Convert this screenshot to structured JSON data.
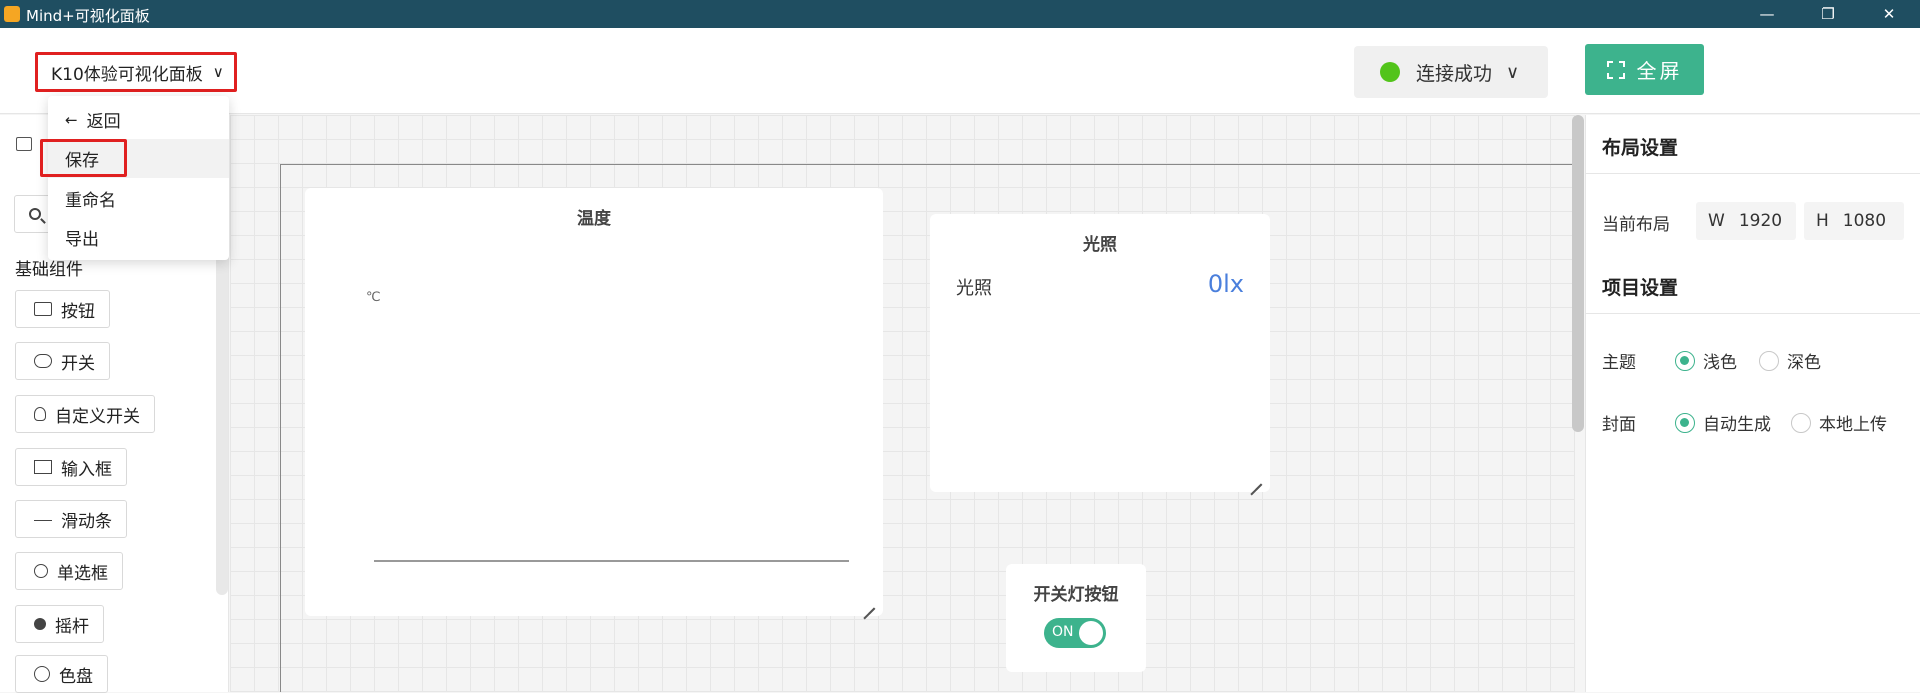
{
  "window": {
    "title": "Mind+可视化面板",
    "controls": [
      "—",
      "❐",
      "✕"
    ]
  },
  "header": {
    "panel_name": "K10体验可视化面板",
    "connection_status": "连接成功",
    "connection_color": "#52c41a",
    "fullscreen_label": "全屏",
    "accent_color": "#3db38d"
  },
  "menu": {
    "items": [
      {
        "label": "返回",
        "icon": "arrow-left-icon"
      },
      {
        "label": "保存"
      },
      {
        "label": "重命名"
      },
      {
        "label": "导出"
      }
    ],
    "highlighted": "保存"
  },
  "sidebar": {
    "group_title": "基础组件",
    "components": [
      {
        "label": "按钮",
        "icon": "button-icon"
      },
      {
        "label": "开关",
        "icon": "switch-icon"
      },
      {
        "label": "自定义开关",
        "icon": "custom-switch-icon"
      },
      {
        "label": "输入框",
        "icon": "input-icon"
      },
      {
        "label": "滑动条",
        "icon": "slider-icon"
      },
      {
        "label": "单选框",
        "icon": "radio-icon"
      },
      {
        "label": "摇杆",
        "icon": "joystick-icon"
      },
      {
        "label": "色盘",
        "icon": "palette-icon"
      }
    ]
  },
  "canvas": {
    "temperature_card": {
      "title": "温度",
      "unit": "℃"
    },
    "light_card": {
      "title": "光照",
      "label": "光照",
      "value": "0lx"
    },
    "switch_card": {
      "title": "开关灯按钮",
      "state": "ON"
    }
  },
  "settings": {
    "layout_title": "布局设置",
    "current_layout_label": "当前布局",
    "width_key": "W",
    "width_value": "1920",
    "height_key": "H",
    "height_value": "1080",
    "project_title": "项目设置",
    "theme_label": "主题",
    "theme_options": [
      "浅色",
      "深色"
    ],
    "theme_selected": "浅色",
    "cover_label": "封面",
    "cover_options": [
      "自动生成",
      "本地上传"
    ],
    "cover_selected": "自动生成"
  }
}
